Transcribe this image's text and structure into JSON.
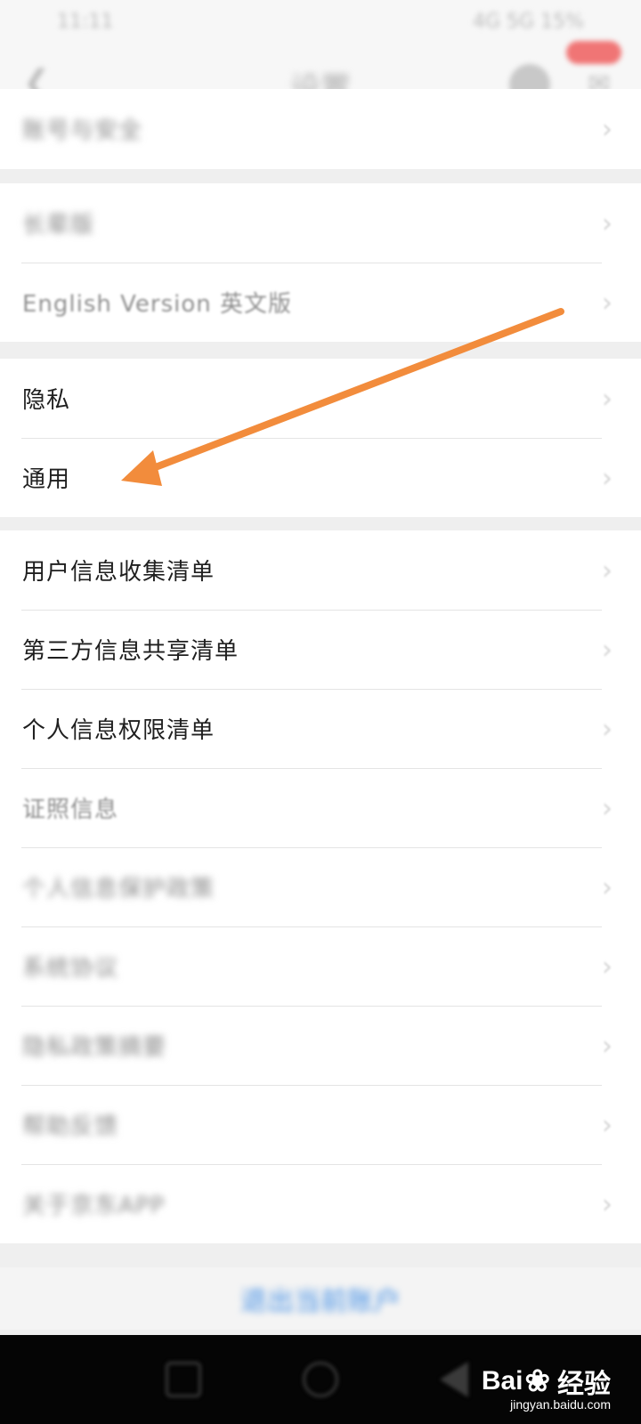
{
  "status_bar": {
    "time": "11:11",
    "system": "4G 5G 15%"
  },
  "header": {
    "title": "设置"
  },
  "groups": [
    {
      "items": [
        {
          "label": "账号与安全"
        }
      ]
    },
    {
      "items": [
        {
          "label": "长辈版"
        },
        {
          "label": "English Version 英文版"
        }
      ]
    },
    {
      "items": [
        {
          "label": "隐私"
        },
        {
          "label": "通用"
        }
      ]
    },
    {
      "items": [
        {
          "label": "用户信息收集清单"
        },
        {
          "label": "第三方信息共享清单"
        },
        {
          "label": "个人信息权限清单"
        },
        {
          "label": "证照信息"
        },
        {
          "label": "个人信息保护政策"
        },
        {
          "label": "系统协议"
        },
        {
          "label": "隐私政策摘要"
        },
        {
          "label": "帮助反馈"
        },
        {
          "label": "关于京东APP"
        }
      ]
    }
  ],
  "footer": {
    "logout_label": "退出当前账户"
  },
  "annotation": {
    "arrow_color": "#f28c3c"
  },
  "watermark": {
    "brand_left": "Bai",
    "brand_right": "经验",
    "url": "jingyan.baidu.com"
  },
  "colors": {
    "background": "#efefef",
    "row_bg": "#ffffff",
    "link_blue": "#4a93e6",
    "arrow_orange": "#f28c3c"
  }
}
